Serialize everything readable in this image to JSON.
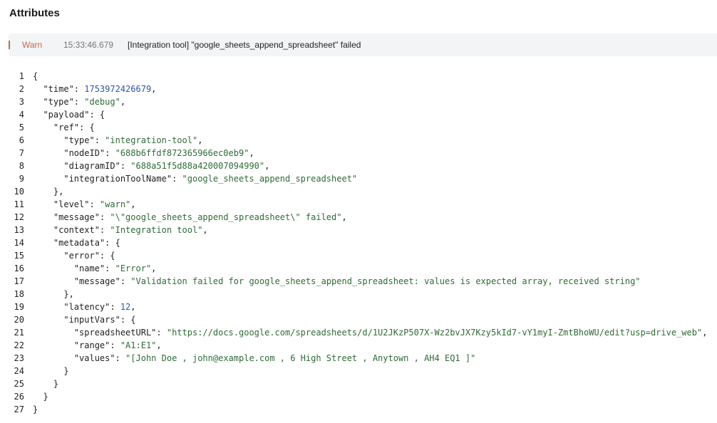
{
  "header": {
    "title": "Attributes"
  },
  "log_entry": {
    "level": "Warn",
    "timestamp": "15:33:46.679",
    "message": "[Integration tool] \"google_sheets_append_spreadsheet\" failed"
  },
  "colors": {
    "warn_accent": "#c26a4d",
    "string": "#2e6b36",
    "number": "#2d55a5",
    "row_background": "#f3f4f5"
  },
  "code": {
    "lines": [
      [
        {
          "t": "{",
          "c": "punc"
        }
      ],
      [
        {
          "t": "  \"time\": ",
          "c": "punc"
        },
        {
          "t": "1753972426679",
          "c": "num"
        },
        {
          "t": ",",
          "c": "punc"
        }
      ],
      [
        {
          "t": "  \"type\": ",
          "c": "punc"
        },
        {
          "t": "\"debug\"",
          "c": "str"
        },
        {
          "t": ",",
          "c": "punc"
        }
      ],
      [
        {
          "t": "  \"payload\": {",
          "c": "punc"
        }
      ],
      [
        {
          "t": "    \"ref\": {",
          "c": "punc"
        }
      ],
      [
        {
          "t": "      \"type\": ",
          "c": "punc"
        },
        {
          "t": "\"integration-tool\"",
          "c": "str"
        },
        {
          "t": ",",
          "c": "punc"
        }
      ],
      [
        {
          "t": "      \"nodeID\": ",
          "c": "punc"
        },
        {
          "t": "\"688b6ffdf872365966ec0eb9\"",
          "c": "str"
        },
        {
          "t": ",",
          "c": "punc"
        }
      ],
      [
        {
          "t": "      \"diagramID\": ",
          "c": "punc"
        },
        {
          "t": "\"688a51f5d88a420007094990\"",
          "c": "str"
        },
        {
          "t": ",",
          "c": "punc"
        }
      ],
      [
        {
          "t": "      \"integrationToolName\": ",
          "c": "punc"
        },
        {
          "t": "\"google_sheets_append_spreadsheet\"",
          "c": "str"
        }
      ],
      [
        {
          "t": "    },",
          "c": "punc"
        }
      ],
      [
        {
          "t": "    \"level\": ",
          "c": "punc"
        },
        {
          "t": "\"warn\"",
          "c": "str"
        },
        {
          "t": ",",
          "c": "punc"
        }
      ],
      [
        {
          "t": "    \"message\": ",
          "c": "punc"
        },
        {
          "t": "\"\\\"google_sheets_append_spreadsheet\\\" failed\"",
          "c": "str"
        },
        {
          "t": ",",
          "c": "punc"
        }
      ],
      [
        {
          "t": "    \"context\": ",
          "c": "punc"
        },
        {
          "t": "\"Integration tool\"",
          "c": "str"
        },
        {
          "t": ",",
          "c": "punc"
        }
      ],
      [
        {
          "t": "    \"metadata\": {",
          "c": "punc"
        }
      ],
      [
        {
          "t": "      \"error\": {",
          "c": "punc"
        }
      ],
      [
        {
          "t": "        \"name\": ",
          "c": "punc"
        },
        {
          "t": "\"Error\"",
          "c": "str"
        },
        {
          "t": ",",
          "c": "punc"
        }
      ],
      [
        {
          "t": "        \"message\": ",
          "c": "punc"
        },
        {
          "t": "\"Validation failed for google_sheets_append_spreadsheet: values is expected array, received string\"",
          "c": "str"
        }
      ],
      [
        {
          "t": "      },",
          "c": "punc"
        }
      ],
      [
        {
          "t": "      \"latency\": ",
          "c": "punc"
        },
        {
          "t": "12",
          "c": "num"
        },
        {
          "t": ",",
          "c": "punc"
        }
      ],
      [
        {
          "t": "      \"inputVars\": {",
          "c": "punc"
        }
      ],
      [
        {
          "t": "        \"spreadsheetURL\": ",
          "c": "punc"
        },
        {
          "t": "\"https://docs.google.com/spreadsheets/d/1U2JKzP507X-Wz2bvJX7Kzy5kId7-vY1myI-ZmtBhoWU/edit?usp=drive_web\"",
          "c": "str"
        },
        {
          "t": ",",
          "c": "punc"
        }
      ],
      [
        {
          "t": "        \"range\": ",
          "c": "punc"
        },
        {
          "t": "\"A1:E1\"",
          "c": "str"
        },
        {
          "t": ",",
          "c": "punc"
        }
      ],
      [
        {
          "t": "        \"values\": ",
          "c": "punc"
        },
        {
          "t": "\"[John Doe , john@example.com , 6 High Street , Anytown , AH4 EQ1 ]\"",
          "c": "str"
        }
      ],
      [
        {
          "t": "      }",
          "c": "punc"
        }
      ],
      [
        {
          "t": "    }",
          "c": "punc"
        }
      ],
      [
        {
          "t": "  }",
          "c": "punc"
        }
      ],
      [
        {
          "t": "}",
          "c": "punc"
        }
      ]
    ]
  }
}
